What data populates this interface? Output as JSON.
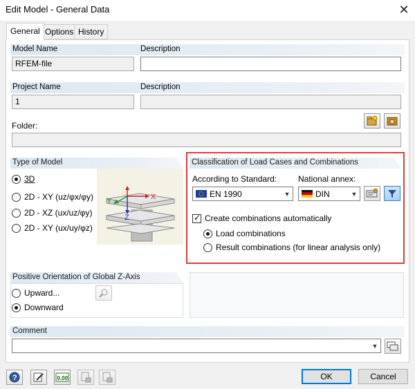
{
  "window": {
    "title": "Edit Model - General Data"
  },
  "tabs": [
    {
      "label": "General"
    },
    {
      "label": "Options"
    },
    {
      "label": "History"
    }
  ],
  "model": {
    "name_label": "Model Name",
    "name_value": "RFEM-file",
    "description_label": "Description",
    "description_value": ""
  },
  "project": {
    "name_label": "Project Name",
    "name_value": "1",
    "description_label": "Description",
    "description_value": ""
  },
  "folder": {
    "label": "Folder:",
    "value": ""
  },
  "type_of_model": {
    "heading": "Type of Model",
    "options": [
      {
        "label": "3D",
        "selected": true
      },
      {
        "label": "2D - XY (uz/φx/φy)",
        "selected": false
      },
      {
        "label": "2D - XZ (ux/uz/φy)",
        "selected": false
      },
      {
        "label": "2D - XY (ux/uy/φz)",
        "selected": false
      }
    ],
    "axis_labels": {
      "x": "X",
      "y": "Y",
      "z": "Z"
    }
  },
  "classification": {
    "heading": "Classification of Load Cases and Combinations",
    "standard_label": "According to Standard:",
    "standard_value": "EN 1990",
    "annex_label": "National annex:",
    "annex_value": "DIN",
    "create_label": "Create combinations automatically",
    "create_checked": true,
    "options": [
      {
        "label": "Load combinations",
        "selected": true
      },
      {
        "label": "Result combinations (for linear analysis only)",
        "selected": false
      }
    ]
  },
  "orientation": {
    "heading": "Positive Orientation of Global Z-Axis",
    "options": [
      {
        "label": "Upward...",
        "selected": false
      },
      {
        "label": "Downward",
        "selected": true
      }
    ]
  },
  "comment": {
    "heading": "Comment",
    "value": ""
  },
  "footer": {
    "ok_label": "OK",
    "cancel_label": "Cancel",
    "units_icon_text": "0.00"
  },
  "colors": {
    "highlight_frame": "#e33b3b",
    "group_header": "#dde8f2",
    "accent": "#0078d7"
  }
}
